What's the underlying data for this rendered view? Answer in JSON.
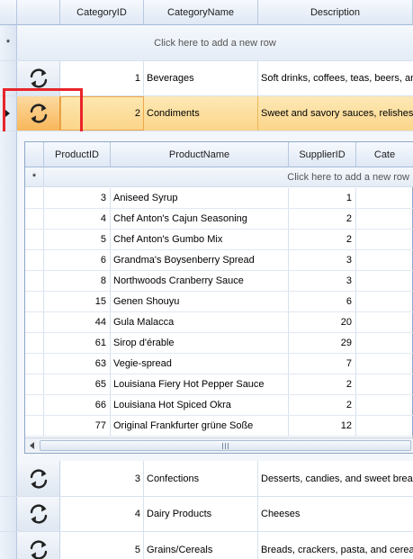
{
  "header": {
    "categoryid_label": "CategoryID",
    "categoryname_label": "CategoryName",
    "description_label": "Description"
  },
  "new_row": {
    "asterisk": "*",
    "text": "Click here to add a new row"
  },
  "categories": [
    {
      "id": "1",
      "name": "Beverages",
      "description": "Soft drinks, coffees, teas, beers, and"
    },
    {
      "id": "2",
      "name": "Condiments",
      "description": "Sweet and savory sauces, relishes, sp"
    },
    {
      "id": "3",
      "name": "Confections",
      "description": "Desserts, candies, and sweet breads"
    },
    {
      "id": "4",
      "name": "Dairy Products",
      "description": "Cheeses"
    },
    {
      "id": "5",
      "name": "Grains/Cereals",
      "description": "Breads, crackers, pasta, and cereal"
    }
  ],
  "child": {
    "headers": {
      "productid": "ProductID",
      "productname": "ProductName",
      "supplierid": "SupplierID",
      "category": "Cate"
    },
    "new_row": {
      "asterisk": "*",
      "text": "Click here to add a new row"
    },
    "rows": [
      {
        "id": "3",
        "name": "Aniseed Syrup",
        "supplier": "1"
      },
      {
        "id": "4",
        "name": "Chef Anton's Cajun Seasoning",
        "supplier": "2"
      },
      {
        "id": "5",
        "name": "Chef Anton's Gumbo Mix",
        "supplier": "2"
      },
      {
        "id": "6",
        "name": "Grandma's Boysenberry Spread",
        "supplier": "3"
      },
      {
        "id": "8",
        "name": "Northwoods Cranberry Sauce",
        "supplier": "3"
      },
      {
        "id": "15",
        "name": "Genen Shouyu",
        "supplier": "6"
      },
      {
        "id": "44",
        "name": "Gula Malacca",
        "supplier": "20"
      },
      {
        "id": "61",
        "name": "Sirop d'érable",
        "supplier": "29"
      },
      {
        "id": "63",
        "name": "Vegie-spread",
        "supplier": "7"
      },
      {
        "id": "65",
        "name": "Louisiana Fiery Hot Pepper Sauce",
        "supplier": "2"
      },
      {
        "id": "66",
        "name": "Louisiana Hot Spiced Okra",
        "supplier": "2"
      },
      {
        "id": "77",
        "name": "Original Frankfurter grüne Soße",
        "supplier": "12"
      }
    ]
  },
  "icons": {
    "refresh": "refresh-icon",
    "row_pointer": "row-pointer-icon",
    "scroll_left": "scroll-left-arrow-icon",
    "scroll_grip": "scroll-grip-icon"
  },
  "colors": {
    "selected_row": "#fbd58a",
    "highlight_box": "#e8252b",
    "header_bg": "#dfe8f5"
  }
}
